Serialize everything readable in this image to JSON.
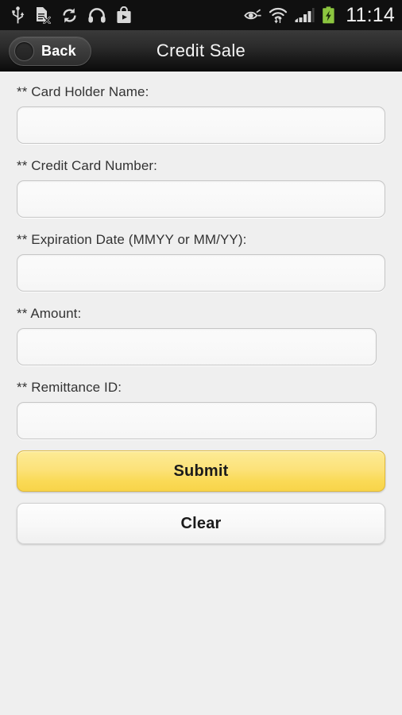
{
  "status_bar": {
    "icons_left": [
      "usb-icon",
      "sd-card-removed-icon",
      "sync-icon",
      "headphones-icon",
      "play-store-icon"
    ],
    "icons_right": [
      "smart-stay-eye-icon",
      "wifi-transfer-icon",
      "signal-bars-icon",
      "battery-charging-icon"
    ],
    "time": "11:14"
  },
  "action_bar": {
    "back_label": "Back",
    "title": "Credit Sale"
  },
  "form": {
    "fields": [
      {
        "label": "** Card Holder Name:",
        "value": "",
        "placeholder": "",
        "name": "card-holder-name"
      },
      {
        "label": "** Credit Card Number:",
        "value": "",
        "placeholder": "",
        "name": "credit-card-number"
      },
      {
        "label": "** Expiration Date (MMYY or MM/YY):",
        "value": "",
        "placeholder": "",
        "name": "expiration-date"
      },
      {
        "label": "** Amount:",
        "value": "",
        "placeholder": "",
        "name": "amount"
      },
      {
        "label": "** Remittance ID:",
        "value": "",
        "placeholder": "",
        "name": "remittance-id"
      }
    ],
    "submit_label": "Submit",
    "clear_label": "Clear"
  },
  "colors": {
    "accent_yellow": "#f9d94e",
    "background": "#efefef",
    "action_bar_dark": "#2c2c2c",
    "status_bar_dark": "#101010",
    "label_text": "#333333",
    "battery_green": "#8cc63f"
  }
}
